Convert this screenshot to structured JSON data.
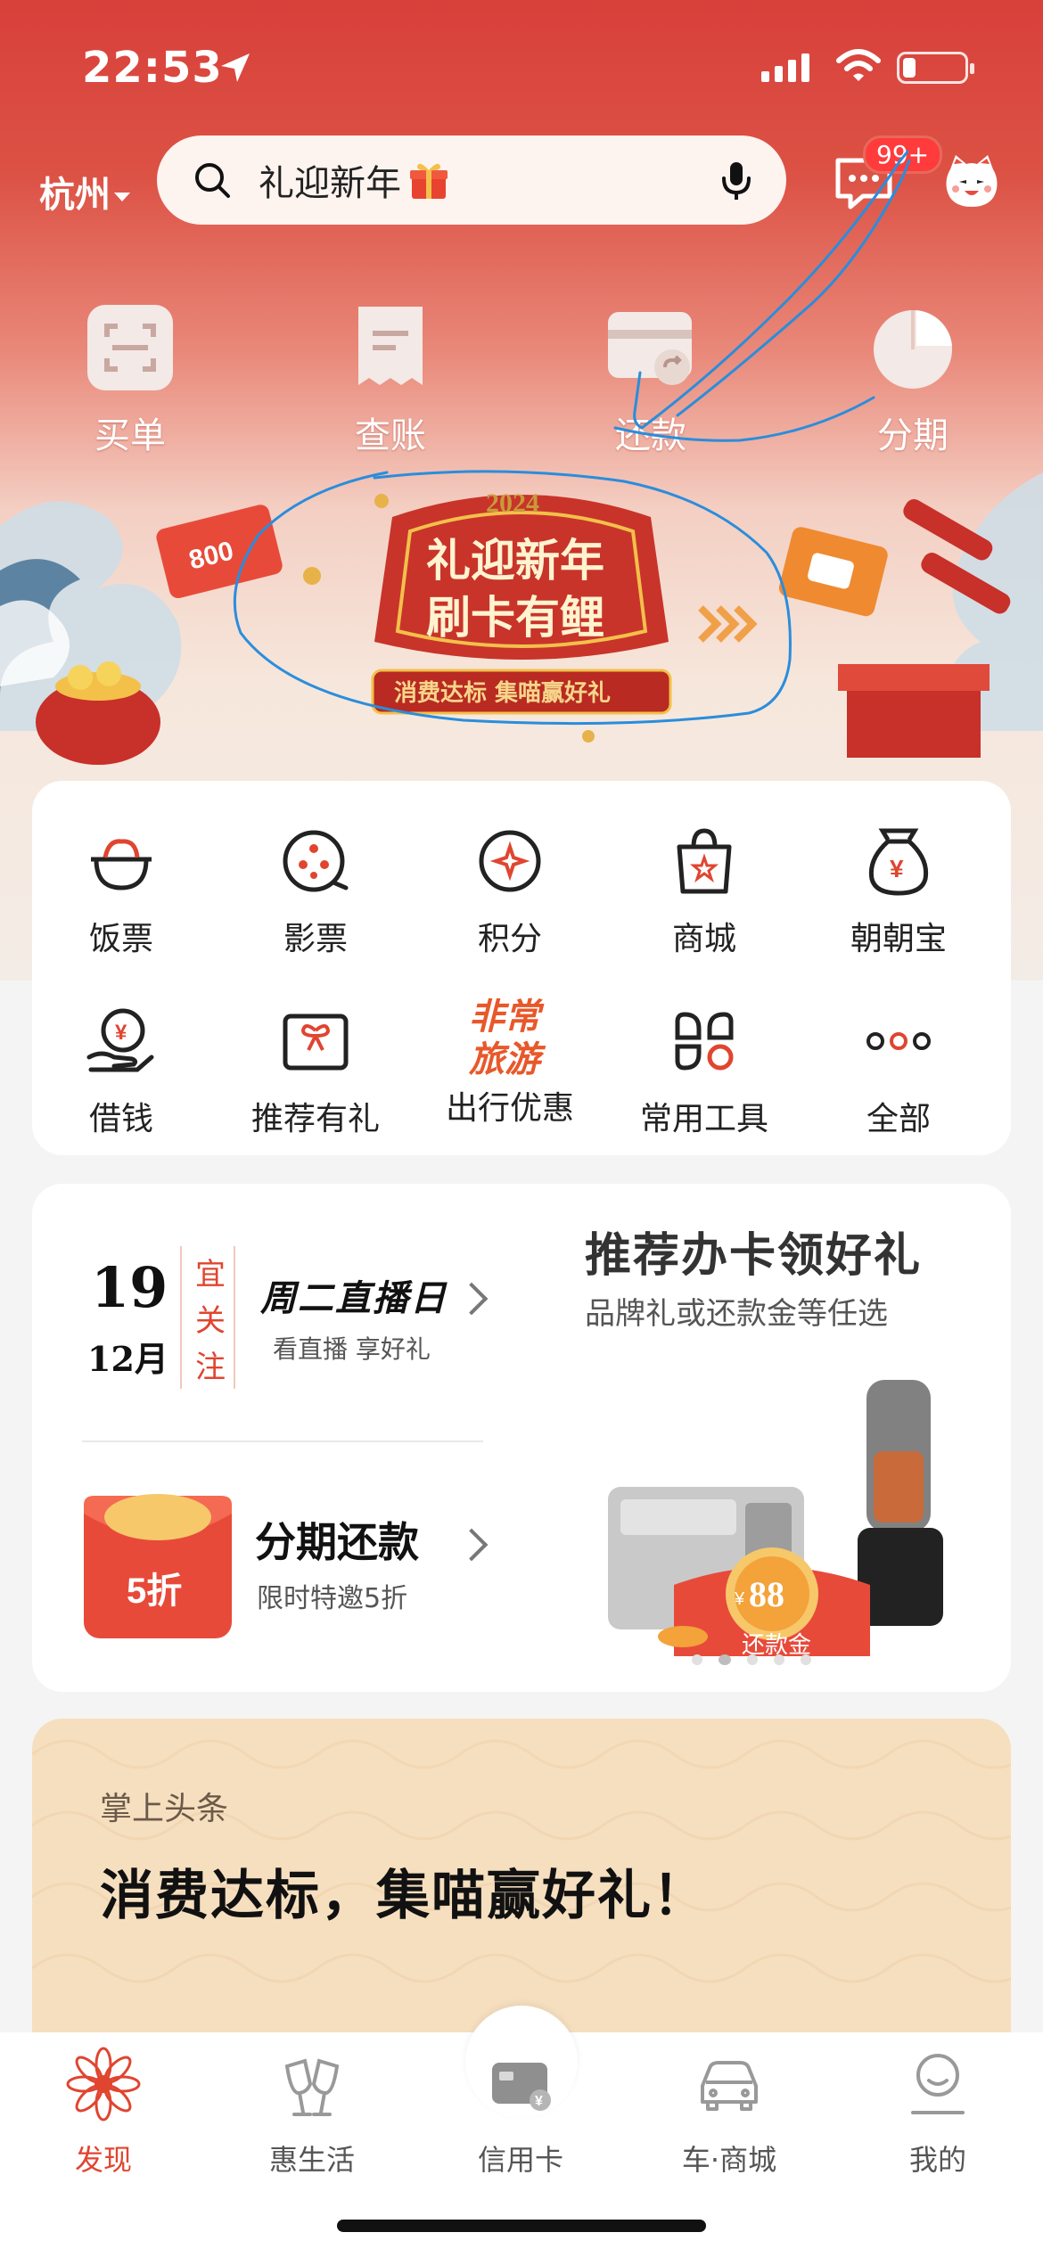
{
  "status_bar": {
    "time": "22:53"
  },
  "header": {
    "city": "杭州",
    "search_placeholder": "礼迎新年",
    "message_badge": "99+"
  },
  "quick_actions": [
    {
      "label": "买单",
      "icon": "scan-pay-icon"
    },
    {
      "label": "查账",
      "icon": "bill-icon"
    },
    {
      "label": "还款",
      "icon": "repay-card-icon"
    },
    {
      "label": "分期",
      "icon": "installment-pie-icon"
    }
  ],
  "banner": {
    "year": "2024",
    "title_line1": "礼迎新年",
    "title_line2": "刷卡有鲤",
    "subtitle": "消费达标 集喵赢好礼",
    "coupon": "800"
  },
  "menu": [
    {
      "label": "饭票",
      "icon": "rice-bowl-icon"
    },
    {
      "label": "影票",
      "icon": "film-reel-icon"
    },
    {
      "label": "积分",
      "icon": "points-icon"
    },
    {
      "label": "商城",
      "icon": "shopping-bag-icon"
    },
    {
      "label": "朝朝宝",
      "icon": "money-bag-icon"
    },
    {
      "label": "借钱",
      "icon": "loan-hand-icon"
    },
    {
      "label": "推荐有礼",
      "icon": "gift-card-icon"
    },
    {
      "label": "出行优惠",
      "icon": "travel-promo-icon",
      "art_text": "非常旅游"
    },
    {
      "label": "常用工具",
      "icon": "tools-icon"
    },
    {
      "label": "全部",
      "icon": "more-dots-icon"
    }
  ],
  "promo": {
    "day": "19",
    "month": "12月",
    "almanac": "宜关注",
    "live_title": "周二直播日",
    "live_sub": "看直播 享好礼",
    "installment_title": "分期还款",
    "installment_sub": "限时特邀5折",
    "envelope_text": "5折",
    "recommend_title": "推荐办卡领好礼",
    "recommend_sub": "品牌礼或还款金等任选",
    "reward_amount": "88",
    "reward_label": "还款金"
  },
  "news": {
    "tag": "掌上头条",
    "title": "消费达标，集喵赢好礼！"
  },
  "tabbar": [
    {
      "label": "发现",
      "icon": "discover-flower-icon",
      "active": true
    },
    {
      "label": "惠生活",
      "icon": "cheers-glasses-icon",
      "active": false
    },
    {
      "label": "信用卡",
      "icon": "credit-card-icon",
      "active": false
    },
    {
      "label": "车·商城",
      "icon": "car-icon",
      "active": false
    },
    {
      "label": "我的",
      "icon": "profile-icon",
      "active": false
    }
  ],
  "colors": {
    "brand_red": "#e04530",
    "annotation_blue": "#2a8ddc"
  }
}
